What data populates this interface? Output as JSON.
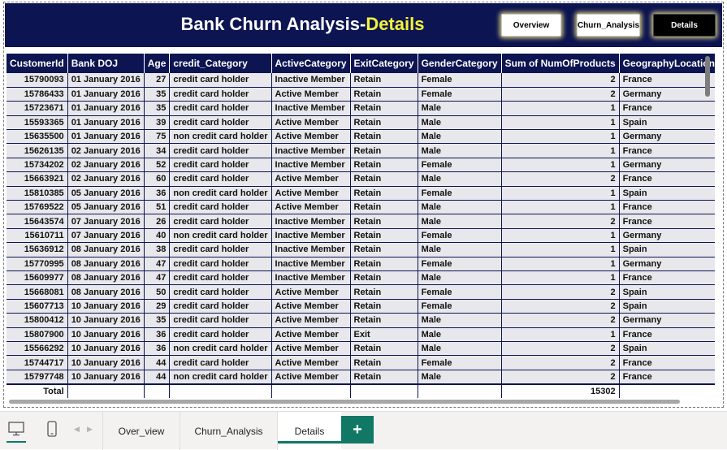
{
  "header": {
    "title_main": "Bank Churn Analysis-",
    "title_highlight": "Details",
    "nav": {
      "overview": "Overview",
      "churn": "Churn_Analysis",
      "details": "Details"
    }
  },
  "table": {
    "columns": [
      "CustomerId",
      "Bank DOJ",
      "Age",
      "credit_Category",
      "ActiveCategory",
      "ExitCategory",
      "GenderCategory",
      "Sum of NumOfProducts",
      "GeographyLocation"
    ],
    "rows": [
      [
        "15790093",
        "01 January 2016",
        "27",
        "credit card holder",
        "Inactive Member",
        "Retain",
        "Female",
        "2",
        "France"
      ],
      [
        "15786433",
        "01 January 2016",
        "35",
        "credit card holder",
        "Active Member",
        "Retain",
        "Female",
        "2",
        "Germany"
      ],
      [
        "15723671",
        "01 January 2016",
        "35",
        "credit card holder",
        "Inactive Member",
        "Retain",
        "Male",
        "1",
        "France"
      ],
      [
        "15593365",
        "01 January 2016",
        "39",
        "credit card holder",
        "Active Member",
        "Retain",
        "Male",
        "1",
        "Spain"
      ],
      [
        "15635500",
        "01 January 2016",
        "75",
        "non credit card holder",
        "Active Member",
        "Retain",
        "Male",
        "1",
        "Germany"
      ],
      [
        "15626135",
        "02 January 2016",
        "34",
        "credit card holder",
        "Inactive Member",
        "Retain",
        "Male",
        "1",
        "France"
      ],
      [
        "15734202",
        "02 January 2016",
        "52",
        "credit card holder",
        "Inactive Member",
        "Retain",
        "Female",
        "1",
        "Germany"
      ],
      [
        "15663921",
        "02 January 2016",
        "60",
        "credit card holder",
        "Active Member",
        "Retain",
        "Male",
        "2",
        "France"
      ],
      [
        "15810385",
        "05 January 2016",
        "36",
        "non credit card holder",
        "Active Member",
        "Retain",
        "Female",
        "1",
        "Spain"
      ],
      [
        "15769522",
        "05 January 2016",
        "51",
        "credit card holder",
        "Active Member",
        "Retain",
        "Male",
        "1",
        "France"
      ],
      [
        "15643574",
        "07 January 2016",
        "26",
        "credit card holder",
        "Inactive Member",
        "Retain",
        "Male",
        "2",
        "France"
      ],
      [
        "15610711",
        "07 January 2016",
        "40",
        "non credit card holder",
        "Inactive Member",
        "Retain",
        "Female",
        "1",
        "Germany"
      ],
      [
        "15636912",
        "08 January 2016",
        "38",
        "credit card holder",
        "Inactive Member",
        "Retain",
        "Male",
        "1",
        "Spain"
      ],
      [
        "15770995",
        "08 January 2016",
        "47",
        "credit card holder",
        "Inactive Member",
        "Retain",
        "Female",
        "1",
        "Germany"
      ],
      [
        "15609977",
        "08 January 2016",
        "47",
        "credit card holder",
        "Inactive Member",
        "Retain",
        "Male",
        "1",
        "France"
      ],
      [
        "15668081",
        "08 January 2016",
        "50",
        "credit card holder",
        "Active Member",
        "Retain",
        "Female",
        "2",
        "Spain"
      ],
      [
        "15607713",
        "10 January 2016",
        "29",
        "credit card holder",
        "Active Member",
        "Retain",
        "Female",
        "2",
        "Spain"
      ],
      [
        "15800412",
        "10 January 2016",
        "35",
        "credit card holder",
        "Active Member",
        "Retain",
        "Male",
        "2",
        "Germany"
      ],
      [
        "15807900",
        "10 January 2016",
        "36",
        "credit card holder",
        "Active Member",
        "Exit",
        "Male",
        "1",
        "France"
      ],
      [
        "15566292",
        "10 January 2016",
        "36",
        "non credit card holder",
        "Active Member",
        "Retain",
        "Male",
        "2",
        "Spain"
      ],
      [
        "15744717",
        "10 January 2016",
        "44",
        "credit card holder",
        "Active Member",
        "Retain",
        "Female",
        "2",
        "France"
      ],
      [
        "15797748",
        "10 January 2016",
        "44",
        "non credit card holder",
        "Active Member",
        "Retain",
        "Male",
        "2",
        "France"
      ]
    ],
    "total_label": "Total",
    "total_value": "15302"
  },
  "tabs": {
    "items": [
      "Over_view",
      "Churn_Analysis",
      "Details"
    ],
    "add_label": "+",
    "prev_arrow": "◀",
    "next_arrow": "▶"
  },
  "colors": {
    "header_bg": "#0c1451",
    "highlight": "#f3f33a",
    "accent": "#117865"
  }
}
